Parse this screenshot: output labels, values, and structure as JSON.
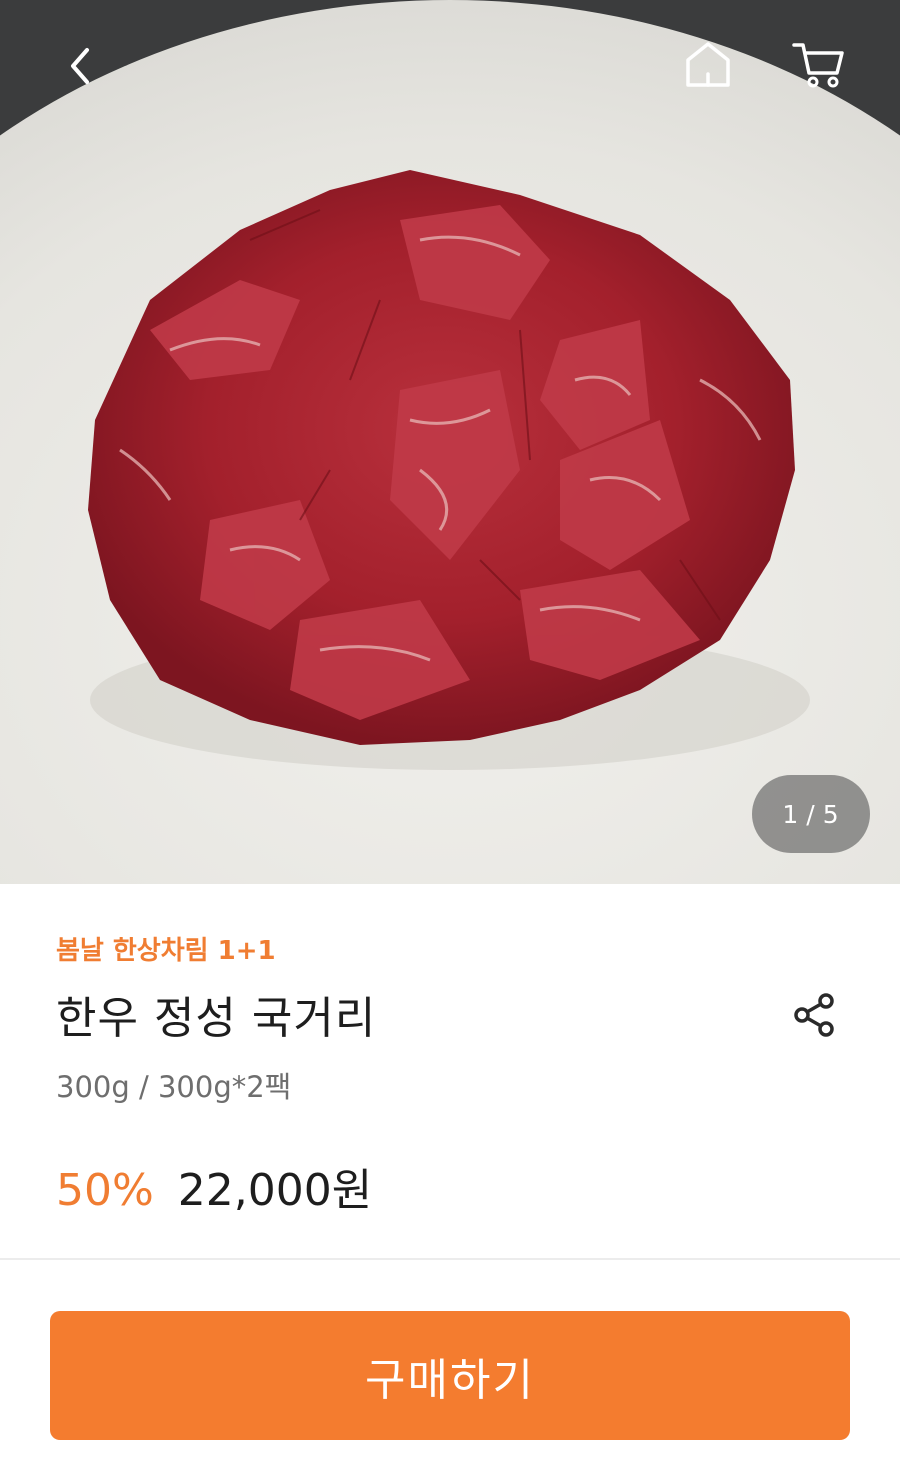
{
  "header": {
    "back_icon": "chevron-left-icon",
    "home_icon": "home-icon",
    "cart_icon": "cart-icon"
  },
  "gallery": {
    "current": "1",
    "separator": "/",
    "total": "5"
  },
  "product": {
    "promo": "봄날 한상차림 1+1",
    "title": "한우 정성 국거리",
    "options": "300g / 300g*2팩",
    "discount": "50%",
    "price": "22,000원",
    "share_icon": "share-icon"
  },
  "actions": {
    "buy_label": "구매하기"
  },
  "colors": {
    "accent": "#f47c2f",
    "promo_text": "#f07d32",
    "title_text": "#1e1e1e",
    "sub_text": "#6e6e6e"
  }
}
